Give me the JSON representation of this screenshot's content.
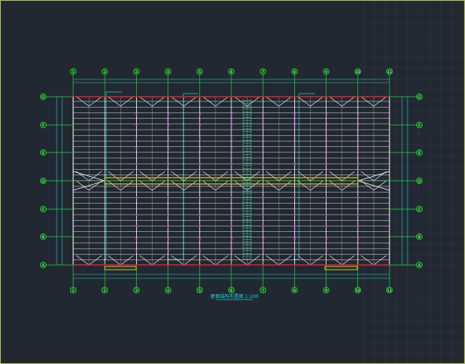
{
  "window": {
    "title": ""
  },
  "colors": {
    "background": "#222831",
    "frame_border": "#b8bf4e",
    "grid_lines": "#2f3a47",
    "axis_lines": "#23d43a",
    "beam_lines": "#ffffff",
    "dimension_lines": "#1fd0d0",
    "eave_line": "#e0202a",
    "ridge_strip": "#c8c82a",
    "bracing_marks": "#e030e0",
    "bubble_fill": "#0b5a10"
  },
  "drawing": {
    "columns": [
      "1",
      "2",
      "3",
      "4",
      "5",
      "6",
      "7",
      "8",
      "9",
      "10",
      "11"
    ],
    "rows": [
      "G",
      "F",
      "E",
      "D",
      "C",
      "B",
      "A"
    ],
    "title": "屋面结构布置图 1:100"
  }
}
